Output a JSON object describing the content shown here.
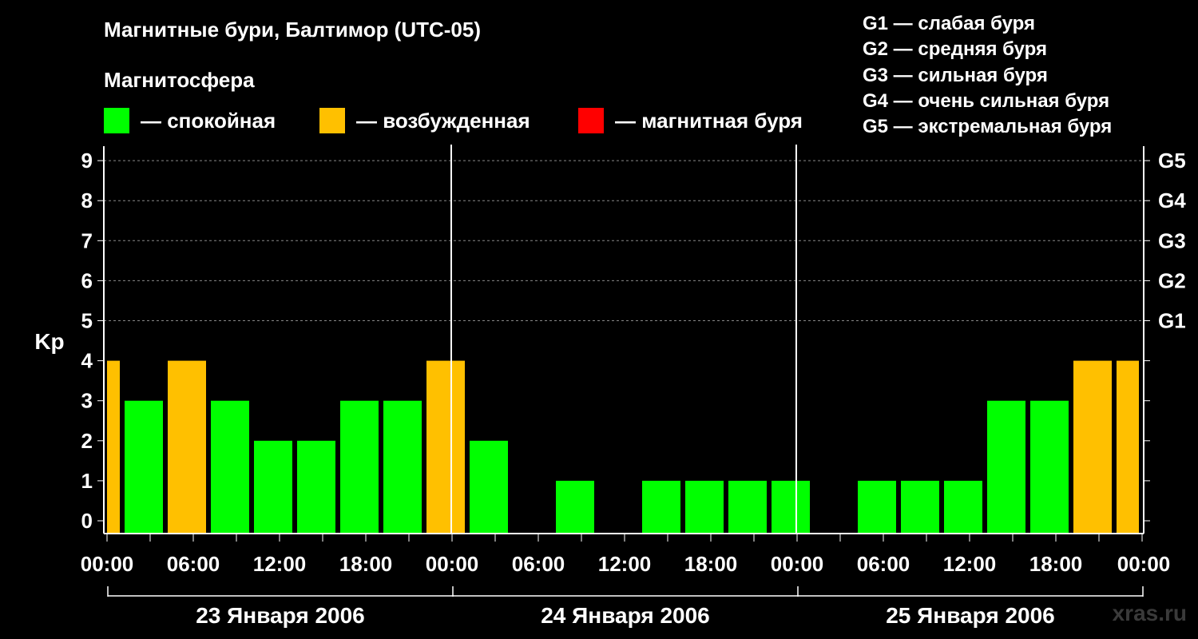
{
  "title": "Магнитные бури, Балтимор (UTC-05)",
  "subtitle": "Магнитосфера",
  "legend": [
    {
      "label": "— спокойная",
      "color": "#00ff00"
    },
    {
      "label": "— возбужденная",
      "color": "#ffc000"
    },
    {
      "label": "— магнитная буря",
      "color": "#ff0000"
    }
  ],
  "storm_levels": [
    "G1 — слабая буря",
    "G2 — средняя буря",
    "G3 — сильная буря",
    "G4 — очень сильная буря",
    "G5 — экстремальная буря"
  ],
  "watermark": "xras.ru",
  "chart_data": {
    "type": "bar",
    "ylabel": "Kp",
    "ylim": [
      0,
      9
    ],
    "yticks": [
      0,
      1,
      2,
      3,
      4,
      5,
      6,
      7,
      8,
      9
    ],
    "right_axis_labels": [
      {
        "kp": 5,
        "label": "G1"
      },
      {
        "kp": 6,
        "label": "G2"
      },
      {
        "kp": 7,
        "label": "G3"
      },
      {
        "kp": 8,
        "label": "G4"
      },
      {
        "kp": 9,
        "label": "G5"
      }
    ],
    "x_tick_labels": [
      "00:00",
      "06:00",
      "12:00",
      "18:00",
      "00:00",
      "06:00",
      "12:00",
      "18:00",
      "00:00",
      "06:00",
      "12:00",
      "18:00",
      "00:00"
    ],
    "day_labels": [
      "23 Января 2006",
      "24 Января 2006",
      "25 Января 2006"
    ],
    "colors": {
      "quiet": "#00ff00",
      "active": "#ffc000",
      "storm": "#ff0000"
    },
    "bars": [
      {
        "start_hour": 0,
        "end_hour": 1,
        "kp": 4
      },
      {
        "start_hour": 1,
        "end_hour": 4,
        "kp": 3
      },
      {
        "start_hour": 4,
        "end_hour": 7,
        "kp": 4
      },
      {
        "start_hour": 7,
        "end_hour": 10,
        "kp": 3
      },
      {
        "start_hour": 10,
        "end_hour": 13,
        "kp": 2
      },
      {
        "start_hour": 13,
        "end_hour": 16,
        "kp": 2
      },
      {
        "start_hour": 16,
        "end_hour": 19,
        "kp": 3
      },
      {
        "start_hour": 19,
        "end_hour": 22,
        "kp": 3
      },
      {
        "start_hour": 22,
        "end_hour": 25,
        "kp": 4
      },
      {
        "start_hour": 25,
        "end_hour": 28,
        "kp": 2
      },
      {
        "start_hour": 28,
        "end_hour": 31,
        "kp": 0
      },
      {
        "start_hour": 31,
        "end_hour": 34,
        "kp": 1
      },
      {
        "start_hour": 34,
        "end_hour": 37,
        "kp": 0
      },
      {
        "start_hour": 37,
        "end_hour": 40,
        "kp": 1
      },
      {
        "start_hour": 40,
        "end_hour": 43,
        "kp": 1
      },
      {
        "start_hour": 43,
        "end_hour": 46,
        "kp": 1
      },
      {
        "start_hour": 46,
        "end_hour": 49,
        "kp": 1
      },
      {
        "start_hour": 49,
        "end_hour": 52,
        "kp": 0
      },
      {
        "start_hour": 52,
        "end_hour": 55,
        "kp": 1
      },
      {
        "start_hour": 55,
        "end_hour": 58,
        "kp": 1
      },
      {
        "start_hour": 58,
        "end_hour": 61,
        "kp": 1
      },
      {
        "start_hour": 61,
        "end_hour": 64,
        "kp": 3
      },
      {
        "start_hour": 64,
        "end_hour": 67,
        "kp": 3
      },
      {
        "start_hour": 67,
        "end_hour": 70,
        "kp": 4
      },
      {
        "start_hour": 70,
        "end_hour": 72,
        "kp": 4
      }
    ]
  }
}
